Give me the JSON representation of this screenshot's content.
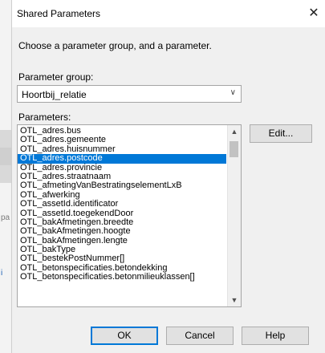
{
  "background_app": {
    "side_text": "pa",
    "side_link": "i"
  },
  "dialog": {
    "title": "Shared Parameters",
    "close_glyph": "✕",
    "instruction": "Choose a parameter group, and a parameter.",
    "group_label": "Parameter group:",
    "group_value": "Hoortbij_relatie",
    "params_label": "Parameters:",
    "params": [
      "OTL_adres.bus",
      "OTL_adres.gemeente",
      "OTL_adres.huisnummer",
      "OTL_adres.postcode",
      "OTL_adres.provincie",
      "OTL_adres.straatnaam",
      "OTL_afmetingVanBestratingselementLxB",
      "OTL_afwerking",
      "OTL_assetId.identificator",
      "OTL_assetId.toegekendDoor",
      "OTL_bakAfmetingen.breedte",
      "OTL_bakAfmetingen.hoogte",
      "OTL_bakAfmetingen.lengte",
      "OTL_bakType",
      "OTL_bestekPostNummer[]",
      "OTL_betonspecificaties.betondekking",
      "OTL_betonspecificaties.betonmilieuklassen[]"
    ],
    "selected_index": 3,
    "buttons": {
      "edit": "Edit...",
      "ok": "OK",
      "cancel": "Cancel",
      "help": "Help"
    }
  }
}
